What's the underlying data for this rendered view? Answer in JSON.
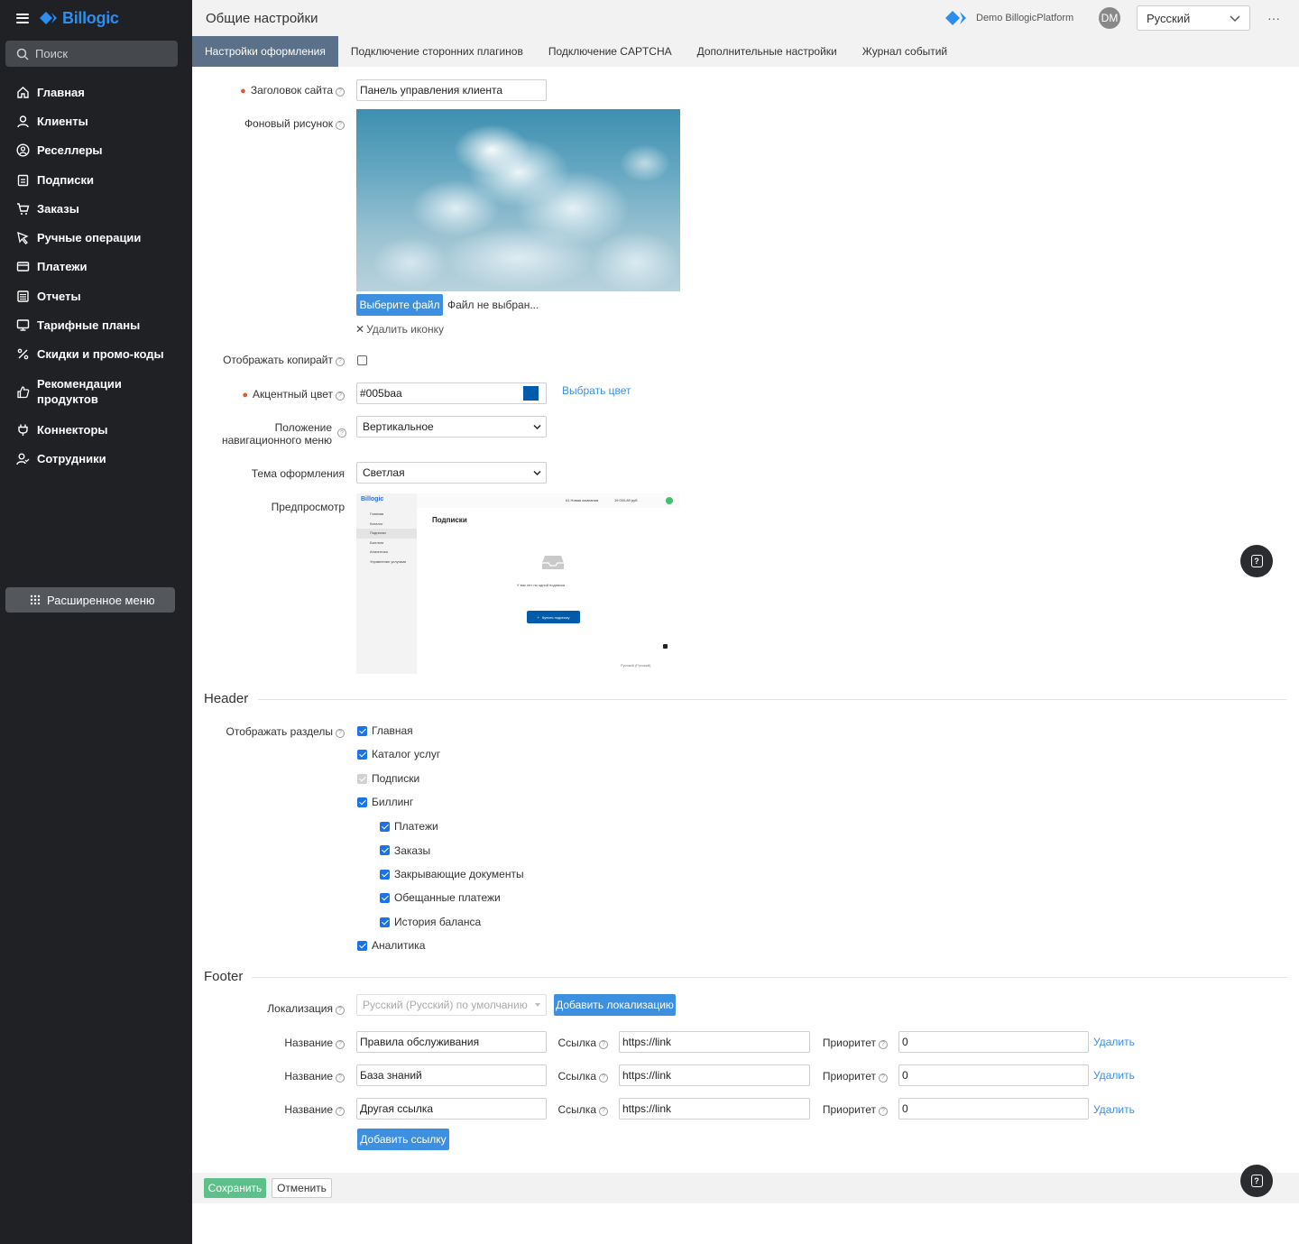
{
  "sidebar": {
    "logo": "Billogic",
    "search_placeholder": "Поиск",
    "items": [
      {
        "label": "Главная"
      },
      {
        "label": "Клиенты"
      },
      {
        "label": "Реселлеры"
      },
      {
        "label": "Подписки"
      },
      {
        "label": "Заказы"
      },
      {
        "label": "Ручные операции"
      },
      {
        "label": "Платежи"
      },
      {
        "label": "Отчеты"
      },
      {
        "label": "Тарифные планы"
      },
      {
        "label": "Скидки и промо-коды"
      },
      {
        "label": "Рекомендации продуктов"
      },
      {
        "label": "Коннекторы"
      },
      {
        "label": "Сотрудники"
      }
    ],
    "extended_menu": "Расширенное меню"
  },
  "header": {
    "title": "Общие настройки",
    "company": "Demo BillogicPlatform",
    "avatar": "DM",
    "language": "Русский"
  },
  "tabs": [
    {
      "label": "Настройки оформления",
      "active": true
    },
    {
      "label": "Подключение сторонних плагинов"
    },
    {
      "label": "Подключение CAPTCHA"
    },
    {
      "label": "Дополнительные настройки"
    },
    {
      "label": "Журнал событий"
    }
  ],
  "form": {
    "site_title_label": "Заголовок сайта",
    "site_title_value": "Панель управления клиента",
    "background_label": "Фоновый рисунок",
    "choose_file": "Выберите файл",
    "no_file": "Файл не выбран...",
    "delete_icon": "Удалить иконку",
    "copyright_label": "Отображать копирайт",
    "accent_label": "Акцентный цвет",
    "accent_value": "#005baa",
    "accent_color": "#005baa",
    "pick_color": "Выбрать цвет",
    "nav_position_label_1": "Положение",
    "nav_position_label_2": "навигационного меню",
    "nav_position_value": "Вертикальное",
    "theme_label": "Тема оформления",
    "theme_value": "Светлая",
    "preview_label": "Предпросмотр"
  },
  "preview": {
    "logo": "Billogic",
    "company": "#1 Новая компания",
    "balance": "19 000,80 руб.",
    "page_title": "Подписки",
    "nav": [
      "Главная",
      "Каталог",
      "Подписки",
      "Биллинг",
      "Аналитика",
      "Управление услугами"
    ],
    "empty_text": "У вас нет ни одной подписки.",
    "buy_button": "Купить подписку",
    "lang": "Русский (Русский)"
  },
  "header_section": {
    "title": "Header",
    "sections_label": "Отображать разделы",
    "items": [
      {
        "label": "Главная",
        "state": "checked"
      },
      {
        "label": "Каталог услуг",
        "state": "checked"
      },
      {
        "label": "Подписки",
        "state": "disabled"
      },
      {
        "label": "Биллинг",
        "state": "checked"
      },
      {
        "label": "Платежи",
        "state": "checked"
      },
      {
        "label": "Заказы",
        "state": "checked"
      },
      {
        "label": "Закрывающие документы",
        "state": "checked"
      },
      {
        "label": "Обещанные платежи",
        "state": "checked"
      },
      {
        "label": "История баланса",
        "state": "checked"
      },
      {
        "label": "Аналитика",
        "state": "checked"
      }
    ]
  },
  "footer_section": {
    "title": "Footer",
    "localization_label": "Локализация",
    "localization_value": "Русский (Русский) по умолчанию",
    "add_localization": "Добавить локализацию",
    "name_label": "Название",
    "link_label": "Ссылка",
    "priority_label": "Приоритет",
    "delete": "Удалить",
    "rows": [
      {
        "name": "Правила обслуживания",
        "link": "https://link",
        "priority": "0"
      },
      {
        "name": "База знаний",
        "link": "https://link",
        "priority": "0"
      },
      {
        "name": "Другая ссылка",
        "link": "https://link",
        "priority": "0"
      }
    ],
    "add_link": "Добавить ссылку"
  },
  "actions": {
    "save": "Сохранить",
    "cancel": "Отменить"
  },
  "colors": {
    "sidebar_bg": "#1f2124",
    "primary": "#3d8fe0",
    "active_tab": "#5b7089",
    "save": "#5dc08a"
  }
}
